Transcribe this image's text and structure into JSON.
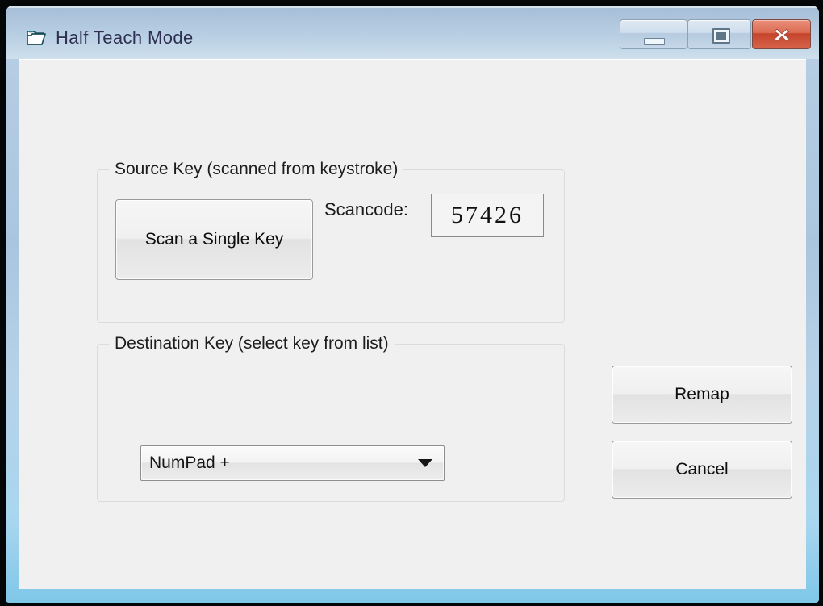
{
  "window": {
    "title": "Half Teach Mode",
    "icon": "folder-icon",
    "controls": {
      "minimize": "minimize-button",
      "maximize": "maximize-button",
      "close": "close-button"
    },
    "titlebar_accent": "#a5bdd7",
    "frame_accent": "#7fc7e8"
  },
  "source_group": {
    "title": "Source Key (scanned from keystroke)",
    "scan_button_label": "Scan a Single Key",
    "scancode_label": "Scancode:",
    "scancode_value": "57426"
  },
  "destination_group": {
    "title": "Destination Key (select key from list)",
    "selected_key": "NumPad +"
  },
  "actions": {
    "remap_label": "Remap",
    "cancel_label": "Cancel"
  }
}
